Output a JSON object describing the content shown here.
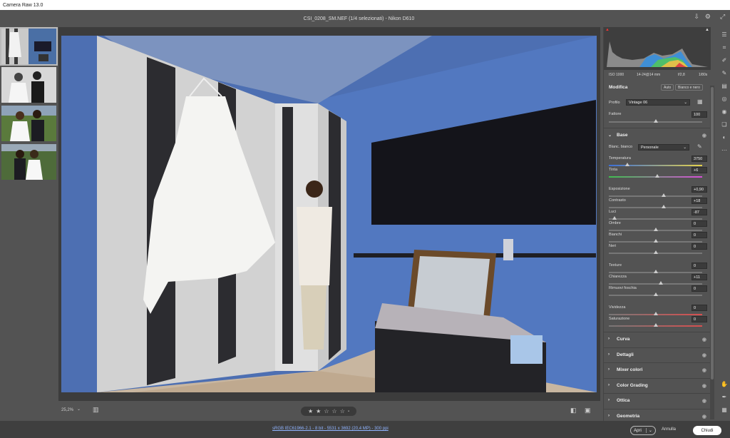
{
  "app": {
    "title": "Camera Raw 13.0"
  },
  "header": {
    "file_title": "CSI_0208_SM.NEF (1/4 selezionati)  -  Nikon D610"
  },
  "canvas": {
    "zoom": "25,2%"
  },
  "rating": {
    "stars": [
      "★",
      "★",
      "☆",
      "☆",
      "☆"
    ]
  },
  "status": {
    "info": "sRGB IEC61966-2.1 - 8 bit - 5531 x 3692 (20,4 MP) - 300 ppi"
  },
  "buttons": {
    "open": "Apri",
    "cancel": "Annulla",
    "done": "Chiudi"
  },
  "exif": {
    "iso": "ISO 1000",
    "lens": "14-24@14 mm",
    "aperture": "f/2,8",
    "shutter": "1/80s"
  },
  "panel": {
    "edit_title": "Modifica",
    "auto_label": "Auto",
    "bw_label": "Bianco e nero",
    "profile_label": "Profilo",
    "profile_value": "Vintage 06",
    "amount_label": "Fattore",
    "amount_value": "100",
    "base_title": "Base",
    "wb_label": "Blanc. bianco",
    "wb_value": "Personale",
    "sliders": [
      {
        "label": "Temperatura",
        "value": "3750",
        "pos": 0.2
      },
      {
        "label": "Tinta",
        "value": "+6",
        "pos": 0.52
      },
      {
        "label": "Esposizione",
        "value": "+0,90",
        "pos": 0.59
      },
      {
        "label": "Contrasto",
        "value": "+18",
        "pos": 0.59
      },
      {
        "label": "Luci",
        "value": "-87",
        "pos": 0.06
      },
      {
        "label": "Ombre",
        "value": "0",
        "pos": 0.5
      },
      {
        "label": "Bianchi",
        "value": "0",
        "pos": 0.5
      },
      {
        "label": "Neri",
        "value": "0",
        "pos": 0.5
      },
      {
        "label": "Texture",
        "value": "0",
        "pos": 0.5
      },
      {
        "label": "Chiarezza",
        "value": "+11",
        "pos": 0.56
      },
      {
        "label": "Rimuovi foschia",
        "value": "0",
        "pos": 0.5
      },
      {
        "label": "Vividezza",
        "value": "0",
        "pos": 0.5
      },
      {
        "label": "Saturazione",
        "value": "0",
        "pos": 0.5
      }
    ],
    "sections": [
      "Curva",
      "Dettagli",
      "Mixer colori",
      "Color Grading",
      "Ottica",
      "Geometria"
    ]
  },
  "colors": {
    "accent": "#8fb3ff",
    "panel": "#535353",
    "histogram_bg": "#3e3e3e"
  }
}
